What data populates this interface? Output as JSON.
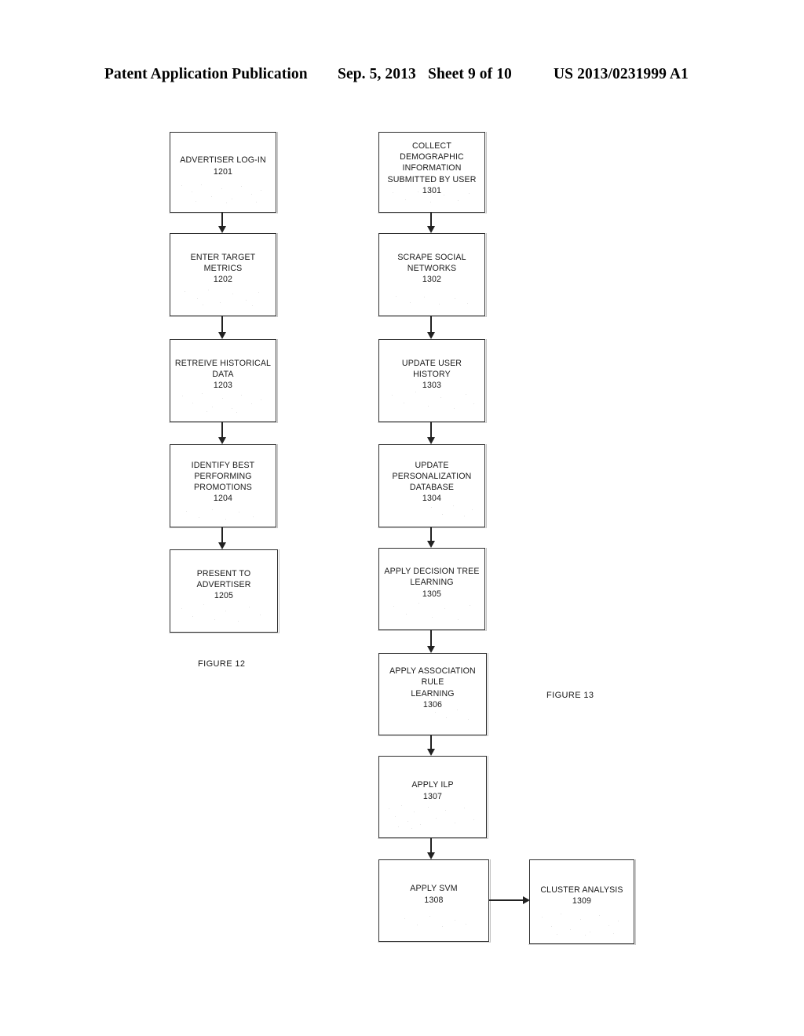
{
  "header": {
    "publication": "Patent Application Publication",
    "date": "Sep. 5, 2013",
    "sheet": "Sheet 9 of 10",
    "doc_number": "US 2013/0231999 A1"
  },
  "figures": [
    {
      "id": "figure-12",
      "caption": "FIGURE 12"
    },
    {
      "id": "figure-13",
      "caption": "FIGURE 13"
    }
  ],
  "flowchart_12": {
    "caption": "FIGURE 12",
    "steps": [
      {
        "ref": "1201",
        "label": "ADVERTISER LOG-IN",
        "text": "ADVERTISER LOG-IN\n1201"
      },
      {
        "ref": "1202",
        "label": "ENTER TARGET METRICS",
        "text": "ENTER TARGET METRICS\n1202"
      },
      {
        "ref": "1203",
        "label": "RETREIVE HISTORICAL DATA",
        "text": "RETREIVE HISTORICAL\nDATA\n1203"
      },
      {
        "ref": "1204",
        "label": "IDENTIFY BEST PERFORMING PROMOTIONS",
        "text": "IDENTIFY BEST\nPERFORMING\nPROMOTIONS\n1204"
      },
      {
        "ref": "1205",
        "label": "PRESENT TO ADVERTISER",
        "text": "PRESENT TO ADVERTISER\n1205"
      }
    ]
  },
  "flowchart_13": {
    "caption": "FIGURE 13",
    "steps": [
      {
        "ref": "1301",
        "label": "COLLECT DEMOGRAPHIC INFORMATION SUBMITTED BY USER",
        "text": "COLLECT DEMOGRAPHIC\nINFORMATION\nSUBMITTED BY USER\n1301"
      },
      {
        "ref": "1302",
        "label": "SCRAPE SOCIAL NETWORKS",
        "text": "SCRAPE SOCIAL\nNETWORKS\n1302"
      },
      {
        "ref": "1303",
        "label": "UPDATE USER HISTORY",
        "text": "UPDATE USER HISTORY\n1303"
      },
      {
        "ref": "1304",
        "label": "UPDATE PERSONALIZATION DATABASE",
        "text": "UPDATE\nPERSONALIZATION\nDATABASE\n1304"
      },
      {
        "ref": "1305",
        "label": "APPLY DECISION TREE LEARNING",
        "text": "APPLY DECISION TREE\nLEARNING\n1305"
      },
      {
        "ref": "1306",
        "label": "APPLY ASSOCIATION RULE LEARNING",
        "text": "APPLY ASSOCIATION RULE\nLEARNING\n1306"
      },
      {
        "ref": "1307",
        "label": "APPLY ILP",
        "text": "APPLY ILP\n1307"
      },
      {
        "ref": "1308",
        "label": "APPLY SVM",
        "text": "APPLY SVM\n1308"
      },
      {
        "ref": "1309",
        "label": "CLUSTER ANALYSIS",
        "text": "CLUSTER ANALYSIS\n1309"
      }
    ]
  },
  "colors": {
    "ink": "#1a1a1a",
    "box_border": "#2e2e2e",
    "page_background": "#ffffff"
  }
}
